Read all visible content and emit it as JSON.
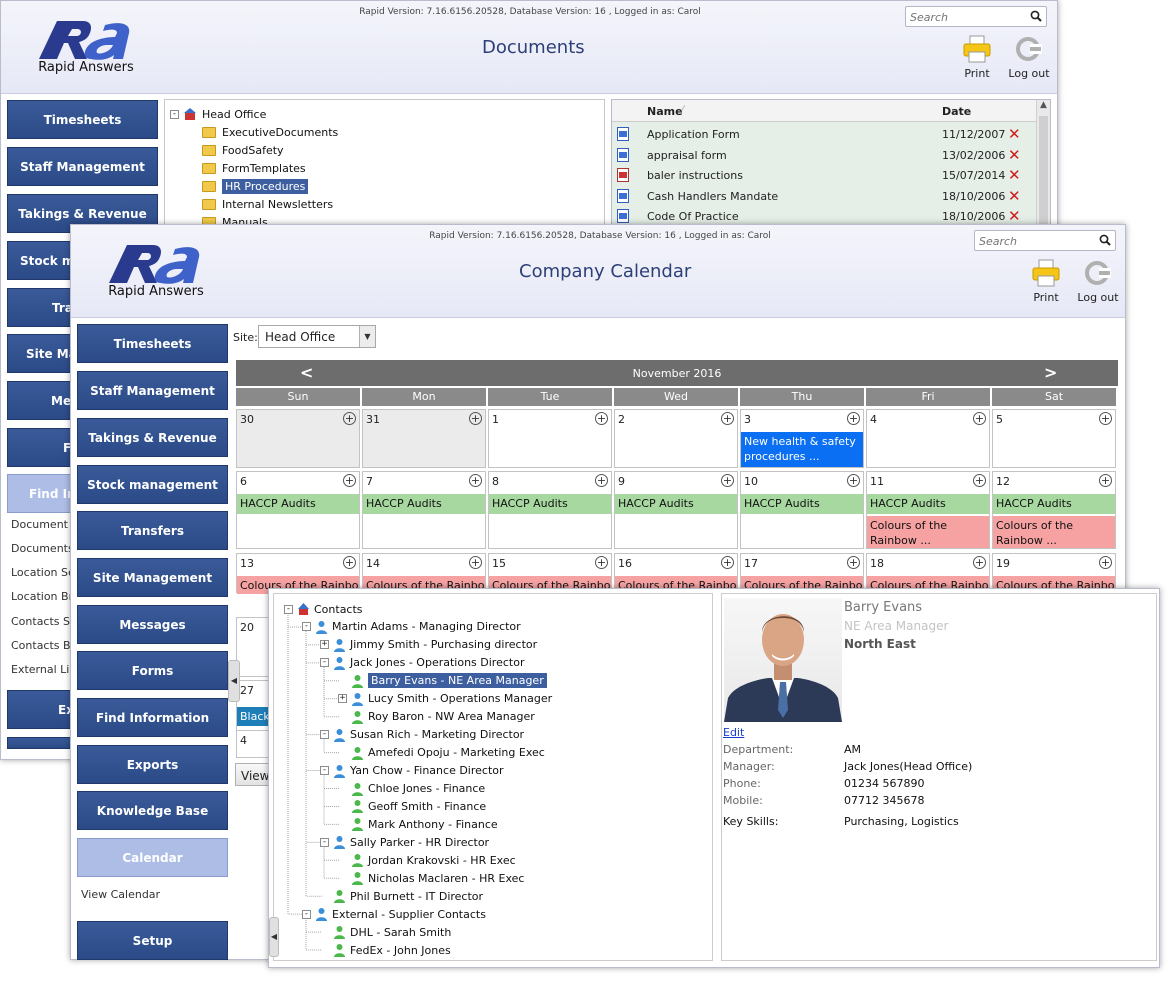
{
  "back_window": {
    "version_text": "Rapid Version: 7.16.6156.20528, Database Version: 16 , Logged in as: Carol",
    "page_title": "Documents",
    "logo_text": "Rapid Answers",
    "search_placeholder": "Search",
    "print_label": "Print",
    "logout_label": "Log out",
    "nav": [
      "Timesheets",
      "Staff Management",
      "Takings & Revenue",
      "Stock m",
      "Tra",
      "Site Ma",
      "Mes",
      "F",
      "Find In",
      "Ex"
    ],
    "subitems": [
      "Document S",
      "Documents",
      "Location Se",
      "Location Br",
      "Contacts Se",
      "Contacts Br",
      "External Lin"
    ],
    "folder_tree": {
      "root": "Head Office",
      "folders": [
        "ExecutiveDocuments",
        "FoodSafety",
        "FormTemplates",
        "HR Procedures",
        "Internal Newsletters",
        "Manuals"
      ],
      "selected": "HR Procedures"
    },
    "doc_grid": {
      "col_name": "Name",
      "col_date": "Date",
      "rows": [
        {
          "name": "Application Form",
          "date": "11/12/2007",
          "icon": "word-doc-icon"
        },
        {
          "name": "appraisal form",
          "date": "13/02/2006",
          "icon": "word-doc-icon"
        },
        {
          "name": "baler instructions",
          "date": "15/07/2014",
          "icon": "pdf-doc-icon"
        },
        {
          "name": "Cash Handlers Mandate",
          "date": "18/10/2006",
          "icon": "word-doc-icon"
        },
        {
          "name": "Code Of Practice",
          "date": "18/10/2006",
          "icon": "word-doc-icon"
        }
      ]
    }
  },
  "calendar_window": {
    "version_text": "Rapid Version: 7.16.6156.20528, Database Version: 16 , Logged in as: Carol",
    "page_title": "Company Calendar",
    "logo_text": "Rapid Answers",
    "search_placeholder": "Search",
    "print_label": "Print",
    "logout_label": "Log out",
    "nav": [
      "Timesheets",
      "Staff Management",
      "Takings & Revenue",
      "Stock management",
      "Transfers",
      "Site Management",
      "Messages",
      "Forms",
      "Find Information",
      "Exports",
      "Knowledge Base",
      "Calendar",
      "Setup"
    ],
    "nav_selected": "Calendar",
    "subitem": "View Calendar",
    "site_label": "Site:",
    "site_value": "Head Office",
    "month_label": "November 2016",
    "prev_label": "<",
    "next_label": ">",
    "days": [
      "Sun",
      "Mon",
      "Tue",
      "Wed",
      "Thu",
      "Fri",
      "Sat"
    ],
    "weeks": [
      [
        {
          "d": "30",
          "other": true
        },
        {
          "d": "31",
          "other": true
        },
        {
          "d": "1"
        },
        {
          "d": "2"
        },
        {
          "d": "3",
          "events": [
            {
              "t": "New health & safety procedures ...",
              "c": "blue"
            }
          ]
        },
        {
          "d": "4"
        },
        {
          "d": "5"
        }
      ],
      [
        {
          "d": "6",
          "events": [
            {
              "t": "HACCP Audits",
              "c": "green"
            }
          ]
        },
        {
          "d": "7",
          "events": [
            {
              "t": "HACCP Audits",
              "c": "green"
            }
          ]
        },
        {
          "d": "8",
          "events": [
            {
              "t": "HACCP Audits",
              "c": "green"
            }
          ]
        },
        {
          "d": "9",
          "events": [
            {
              "t": "HACCP Audits",
              "c": "green"
            }
          ]
        },
        {
          "d": "10",
          "events": [
            {
              "t": "HACCP Audits",
              "c": "green"
            }
          ]
        },
        {
          "d": "11",
          "events": [
            {
              "t": "HACCP Audits",
              "c": "green"
            },
            {
              "t": "Colours of the Rainbow ...",
              "c": "red"
            }
          ]
        },
        {
          "d": "12",
          "events": [
            {
              "t": "HACCP Audits",
              "c": "green"
            },
            {
              "t": "Colours of the Rainbow ...",
              "c": "red"
            }
          ]
        }
      ],
      [
        {
          "d": "13",
          "events": [
            {
              "t": "Colours of the Rainbow ...",
              "c": "red"
            }
          ]
        },
        {
          "d": "14",
          "events": [
            {
              "t": "Colours of the Rainbow",
              "c": "red"
            }
          ]
        },
        {
          "d": "15",
          "events": [
            {
              "t": "Colours of the Rainbow",
              "c": "red"
            }
          ]
        },
        {
          "d": "16",
          "events": [
            {
              "t": "Colours of the Rainbow",
              "c": "red"
            }
          ]
        },
        {
          "d": "17",
          "events": [
            {
              "t": "Colours of the Rainbow",
              "c": "red"
            }
          ]
        },
        {
          "d": "18",
          "events": [
            {
              "t": "Colours of the Rainbow",
              "c": "red"
            }
          ]
        },
        {
          "d": "19",
          "events": [
            {
              "t": "Colours of the Rainbow",
              "c": "red"
            }
          ]
        }
      ]
    ],
    "peek": {
      "d20": "20",
      "d27": "27",
      "black_event": "Black",
      "d4": "4",
      "view_btn": "View"
    }
  },
  "contacts_window": {
    "tree": [
      {
        "label": "Contacts",
        "level": 0,
        "exp": "-",
        "icon": "contacts-root-icon"
      },
      {
        "label": "Martin Adams - Managing Director",
        "level": 1,
        "exp": "-",
        "icon": "person-blue-icon"
      },
      {
        "label": "Jimmy Smith - Purchasing director",
        "level": 2,
        "exp": "+",
        "icon": "person-blue-icon"
      },
      {
        "label": "Jack Jones - Operations Director",
        "level": 2,
        "exp": "-",
        "icon": "person-blue-icon"
      },
      {
        "label": "Barry Evans - NE Area Manager",
        "level": 3,
        "exp": "",
        "icon": "person-green-icon",
        "selected": true
      },
      {
        "label": "Lucy Smith - Operations Manager",
        "level": 3,
        "exp": "+",
        "icon": "person-blue-icon"
      },
      {
        "label": "Roy Baron - NW Area Manager",
        "level": 3,
        "exp": "",
        "icon": "person-green-icon"
      },
      {
        "label": "Susan Rich - Marketing Director",
        "level": 2,
        "exp": "-",
        "icon": "person-blue-icon"
      },
      {
        "label": "Amefedi Opoju - Marketing Exec",
        "level": 3,
        "exp": "",
        "icon": "person-green-icon"
      },
      {
        "label": "Yan Chow - Finance Director",
        "level": 2,
        "exp": "-",
        "icon": "person-blue-icon"
      },
      {
        "label": "Chloe Jones - Finance",
        "level": 3,
        "exp": "",
        "icon": "person-green-icon"
      },
      {
        "label": "Geoff Smith - Finance",
        "level": 3,
        "exp": "",
        "icon": "person-green-icon"
      },
      {
        "label": "Mark Anthony - Finance",
        "level": 3,
        "exp": "",
        "icon": "person-green-icon"
      },
      {
        "label": "Sally Parker - HR Director",
        "level": 2,
        "exp": "-",
        "icon": "person-blue-icon"
      },
      {
        "label": "Jordan Krakovski - HR Exec",
        "level": 3,
        "exp": "",
        "icon": "person-green-icon"
      },
      {
        "label": "Nicholas Maclaren - HR Exec",
        "level": 3,
        "exp": "",
        "icon": "person-green-icon"
      },
      {
        "label": "Phil Burnett - IT Director",
        "level": 2,
        "exp": "",
        "icon": "person-green-icon"
      },
      {
        "label": "External - Supplier Contacts",
        "level": 1,
        "exp": "-",
        "icon": "person-blue-icon"
      },
      {
        "label": "DHL - Sarah Smith",
        "level": 2,
        "exp": "",
        "icon": "person-green-icon"
      },
      {
        "label": "FedEx - John Jones",
        "level": 2,
        "exp": "",
        "icon": "person-green-icon"
      }
    ],
    "detail": {
      "name": "Barry Evans",
      "role": "NE Area Manager",
      "region": "North East",
      "edit_link": "Edit",
      "fields": [
        {
          "label": "Department:",
          "value": "AM"
        },
        {
          "label": "Manager:",
          "value": "Jack Jones(Head Office)"
        },
        {
          "label": "Phone:",
          "value": "01234 567890"
        },
        {
          "label": "Mobile:",
          "value": "07712 345678"
        }
      ],
      "skills_label": "Key Skills:",
      "skills_value": "Purchasing, Logistics"
    }
  }
}
